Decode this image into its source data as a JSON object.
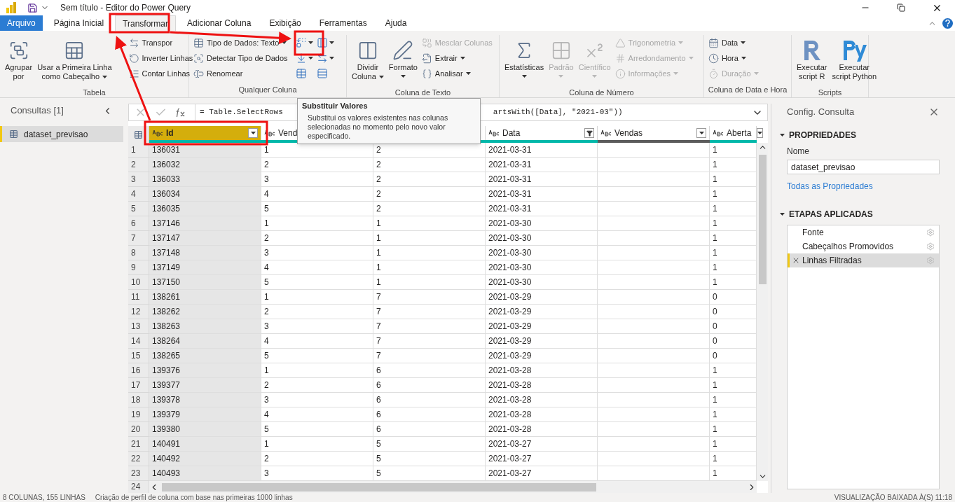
{
  "window": {
    "title": "Sem título - Editor do Power Query"
  },
  "tabs": [
    {
      "label": "Arquivo",
      "kind": "file",
      "selected": false
    },
    {
      "label": "Página Inicial",
      "kind": "tab",
      "selected": false
    },
    {
      "label": "Transformar",
      "kind": "tab",
      "selected": true
    },
    {
      "label": "Adicionar Coluna",
      "kind": "tab",
      "selected": false
    },
    {
      "label": "Exibição",
      "kind": "tab",
      "selected": false
    },
    {
      "label": "Ferramentas",
      "kind": "tab",
      "selected": false
    },
    {
      "label": "Ajuda",
      "kind": "tab",
      "selected": false
    }
  ],
  "ribbon": [
    {
      "label": "Tabela",
      "columns": [
        [
          {
            "kind": "large",
            "lines": [
              "Agrupar",
              "por"
            ],
            "dropdown": false,
            "disabled": false
          }
        ],
        [
          {
            "kind": "large",
            "lines": [
              "Usar a Primeira Linha",
              "como Cabeçalho"
            ],
            "dropdown": true,
            "disabled": false
          }
        ],
        [
          {
            "kind": "small",
            "label": "Transpor",
            "dropdown": false,
            "disabled": false
          },
          {
            "kind": "small",
            "label": "Inverter Linhas",
            "dropdown": false,
            "disabled": false
          },
          {
            "kind": "small",
            "label": "Contar Linhas",
            "dropdown": false,
            "disabled": false
          }
        ]
      ]
    },
    {
      "label": "Qualquer Coluna",
      "columns": [
        [
          {
            "kind": "small",
            "label": "Tipo de Dados: Texto",
            "dropdown": true,
            "disabled": false
          },
          {
            "kind": "small",
            "label": "Detectar Tipo de Dados",
            "dropdown": false,
            "disabled": false
          },
          {
            "kind": "small",
            "label": "Renomear",
            "dropdown": false,
            "disabled": false
          }
        ],
        [
          {
            "kind": "icon",
            "dropdown": true,
            "disabled": false
          },
          {
            "kind": "icon",
            "dropdown": true,
            "disabled": false
          },
          {
            "kind": "icon",
            "dropdown": false,
            "disabled": false
          }
        ],
        [
          {
            "kind": "icon",
            "dropdown": true,
            "disabled": false
          },
          {
            "kind": "icon",
            "dropdown": true,
            "disabled": false
          },
          {
            "kind": "icon",
            "dropdown": false,
            "disabled": false
          }
        ]
      ]
    },
    {
      "label": "Coluna de Texto",
      "columns": [
        [
          {
            "kind": "large",
            "lines": [
              "Dividir",
              "Coluna"
            ],
            "dropdown": true,
            "disabled": false
          }
        ],
        [
          {
            "kind": "large",
            "lines": [
              "Formato"
            ],
            "dropdown": true,
            "disabled": false
          }
        ],
        [
          {
            "kind": "small",
            "label": "Mesclar Colunas",
            "dropdown": false,
            "disabled": true
          },
          {
            "kind": "small",
            "label": "Extrair",
            "dropdown": true,
            "disabled": false
          },
          {
            "kind": "small",
            "label": "Analisar",
            "dropdown": true,
            "disabled": false
          }
        ]
      ]
    },
    {
      "label": "Coluna de Número",
      "columns": [
        [
          {
            "kind": "large",
            "lines": [
              "Estatísticas"
            ],
            "dropdown": true,
            "disabled": false
          }
        ],
        [
          {
            "kind": "large",
            "lines": [
              "Padrão"
            ],
            "dropdown": true,
            "disabled": true
          }
        ],
        [
          {
            "kind": "large",
            "lines": [
              "Científico"
            ],
            "dropdown": true,
            "disabled": true
          }
        ],
        [
          {
            "kind": "small",
            "label": "Trigonometria",
            "dropdown": true,
            "disabled": true
          },
          {
            "kind": "small",
            "label": "Arredondamento",
            "dropdown": true,
            "disabled": true
          },
          {
            "kind": "small",
            "label": "Informações",
            "dropdown": true,
            "disabled": true
          }
        ]
      ]
    },
    {
      "label": "Coluna de Data e Hora",
      "columns": [
        [
          {
            "kind": "small",
            "label": "Data",
            "dropdown": true,
            "disabled": false
          },
          {
            "kind": "small",
            "label": "Hora",
            "dropdown": true,
            "disabled": false
          },
          {
            "kind": "small",
            "label": "Duração",
            "dropdown": true,
            "disabled": true
          }
        ]
      ]
    },
    {
      "label": "Scripts",
      "columns": [
        [
          {
            "kind": "large",
            "lines": [
              "Executar",
              "script R"
            ],
            "dropdown": false,
            "disabled": false
          }
        ],
        [
          {
            "kind": "large",
            "lines": [
              "Executar",
              "script Python"
            ],
            "dropdown": false,
            "disabled": false
          }
        ]
      ]
    }
  ],
  "queries": {
    "title": "Consultas [1]",
    "items": [
      {
        "label": "dataset_previsao",
        "selected": true
      }
    ]
  },
  "formula": {
    "parts": [
      "= Table.SelectRows",
      "artsWith([Data], \"2021-03\"))"
    ]
  },
  "tooltip": {
    "title": "Substituir Valores",
    "text": "Substitui os valores existentes nas colunas selecionadas no momento pelo novo valor especificado."
  },
  "table": {
    "columns": [
      {
        "label": "Id",
        "selected": true,
        "filtered": false,
        "empty": false
      },
      {
        "label": "Vend",
        "selected": false,
        "empty": false
      },
      {
        "selected": false,
        "empty": false
      },
      {
        "label": "Data",
        "selected": false,
        "filtered": true,
        "empty": false
      },
      {
        "label": "Vendas",
        "selected": false,
        "filtered": false,
        "empty": true
      },
      {
        "label": "Aberta",
        "selected": false,
        "filtered": false,
        "empty": false
      }
    ],
    "rows": [
      {
        "n": "1",
        "cells": [
          "136031",
          "1",
          "2",
          "2021-03-31",
          "",
          "1"
        ]
      },
      {
        "n": "2",
        "cells": [
          "136032",
          "2",
          "2",
          "2021-03-31",
          "",
          "1"
        ]
      },
      {
        "n": "3",
        "cells": [
          "136033",
          "3",
          "2",
          "2021-03-31",
          "",
          "1"
        ]
      },
      {
        "n": "4",
        "cells": [
          "136034",
          "4",
          "2",
          "2021-03-31",
          "",
          "1"
        ]
      },
      {
        "n": "5",
        "cells": [
          "136035",
          "5",
          "2",
          "2021-03-31",
          "",
          "1"
        ]
      },
      {
        "n": "6",
        "cells": [
          "137146",
          "1",
          "1",
          "2021-03-30",
          "",
          "1"
        ]
      },
      {
        "n": "7",
        "cells": [
          "137147",
          "2",
          "1",
          "2021-03-30",
          "",
          "1"
        ]
      },
      {
        "n": "8",
        "cells": [
          "137148",
          "3",
          "1",
          "2021-03-30",
          "",
          "1"
        ]
      },
      {
        "n": "9",
        "cells": [
          "137149",
          "4",
          "1",
          "2021-03-30",
          "",
          "1"
        ]
      },
      {
        "n": "10",
        "cells": [
          "137150",
          "5",
          "1",
          "2021-03-30",
          "",
          "1"
        ]
      },
      {
        "n": "11",
        "cells": [
          "138261",
          "1",
          "7",
          "2021-03-29",
          "",
          "0"
        ]
      },
      {
        "n": "12",
        "cells": [
          "138262",
          "2",
          "7",
          "2021-03-29",
          "",
          "0"
        ]
      },
      {
        "n": "13",
        "cells": [
          "138263",
          "3",
          "7",
          "2021-03-29",
          "",
          "0"
        ]
      },
      {
        "n": "14",
        "cells": [
          "138264",
          "4",
          "7",
          "2021-03-29",
          "",
          "0"
        ]
      },
      {
        "n": "15",
        "cells": [
          "138265",
          "5",
          "7",
          "2021-03-29",
          "",
          "0"
        ]
      },
      {
        "n": "16",
        "cells": [
          "139376",
          "1",
          "6",
          "2021-03-28",
          "",
          "1"
        ]
      },
      {
        "n": "17",
        "cells": [
          "139377",
          "2",
          "6",
          "2021-03-28",
          "",
          "1"
        ]
      },
      {
        "n": "18",
        "cells": [
          "139378",
          "3",
          "6",
          "2021-03-28",
          "",
          "1"
        ]
      },
      {
        "n": "19",
        "cells": [
          "139379",
          "4",
          "6",
          "2021-03-28",
          "",
          "1"
        ]
      },
      {
        "n": "20",
        "cells": [
          "139380",
          "5",
          "6",
          "2021-03-28",
          "",
          "1"
        ]
      },
      {
        "n": "21",
        "cells": [
          "140491",
          "1",
          "5",
          "2021-03-27",
          "",
          "1"
        ]
      },
      {
        "n": "22",
        "cells": [
          "140492",
          "2",
          "5",
          "2021-03-27",
          "",
          "1"
        ]
      },
      {
        "n": "23",
        "cells": [
          "140493",
          "3",
          "5",
          "2021-03-27",
          "",
          "1"
        ]
      }
    ],
    "last_row_number": "24"
  },
  "settings": {
    "title": "Config. Consulta",
    "properties_heading": "PROPRIEDADES",
    "name_label": "Nome",
    "name_value": "dataset_previsao",
    "all_properties_link": "Todas as Propriedades",
    "steps_heading": "ETAPAS APLICADAS",
    "steps": [
      {
        "label": "Fonte",
        "selected": false
      },
      {
        "label": "Cabeçalhos Promovidos",
        "selected": false
      },
      {
        "label": "Linhas Filtradas",
        "selected": true
      }
    ]
  },
  "status_bar": {
    "left": "8 COLUNAS, 155 LINHAS",
    "middle": "Criação de perfil de coluna com base nas primeiras 1000 linhas",
    "right": "VISUALIZAÇÃO BAIXADA À(S) 11:18"
  }
}
